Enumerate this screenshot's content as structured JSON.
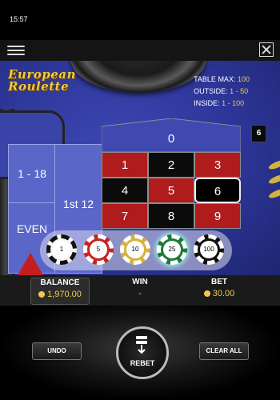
{
  "status": {
    "time": "15:57"
  },
  "header": {
    "menu_icon": "hamburger-menu-icon",
    "close_icon": "close-icon"
  },
  "game": {
    "logo_line1": "European",
    "logo_line2": "Roulette",
    "limits": [
      {
        "key": "TABLE MAX:",
        "value": "100"
      },
      {
        "key": "OUTSIDE:",
        "value": "1 - 50"
      },
      {
        "key": "INSIDE:",
        "value": "1 - 100"
      }
    ],
    "last_number": "6",
    "outside_bets": {
      "low": "1 - 18",
      "even": "EVEN",
      "dozen": "1st 12"
    },
    "zero": "0",
    "numbers": [
      {
        "n": "1",
        "color": "red"
      },
      {
        "n": "2",
        "color": "black"
      },
      {
        "n": "3",
        "color": "red"
      },
      {
        "n": "4",
        "color": "black"
      },
      {
        "n": "5",
        "color": "red"
      },
      {
        "n": "6",
        "color": "black"
      },
      {
        "n": "7",
        "color": "red"
      },
      {
        "n": "8",
        "color": "black"
      },
      {
        "n": "9",
        "color": "red"
      }
    ],
    "chips": [
      "1",
      "5",
      "10",
      "25",
      "100"
    ],
    "selected_chip": "25"
  },
  "info": {
    "balance_label": "BALANCE",
    "balance_value": "1,970.00",
    "win_label": "WIN",
    "win_value": "-",
    "bet_label": "BET",
    "bet_value": "30.00"
  },
  "actions": {
    "undo": "UNDO",
    "rebet": "REBET",
    "clear_all": "CLEAR ALL"
  },
  "colors": {
    "table": "#2c3596",
    "red": "#b01c1c",
    "gold": "#f3c84c"
  }
}
